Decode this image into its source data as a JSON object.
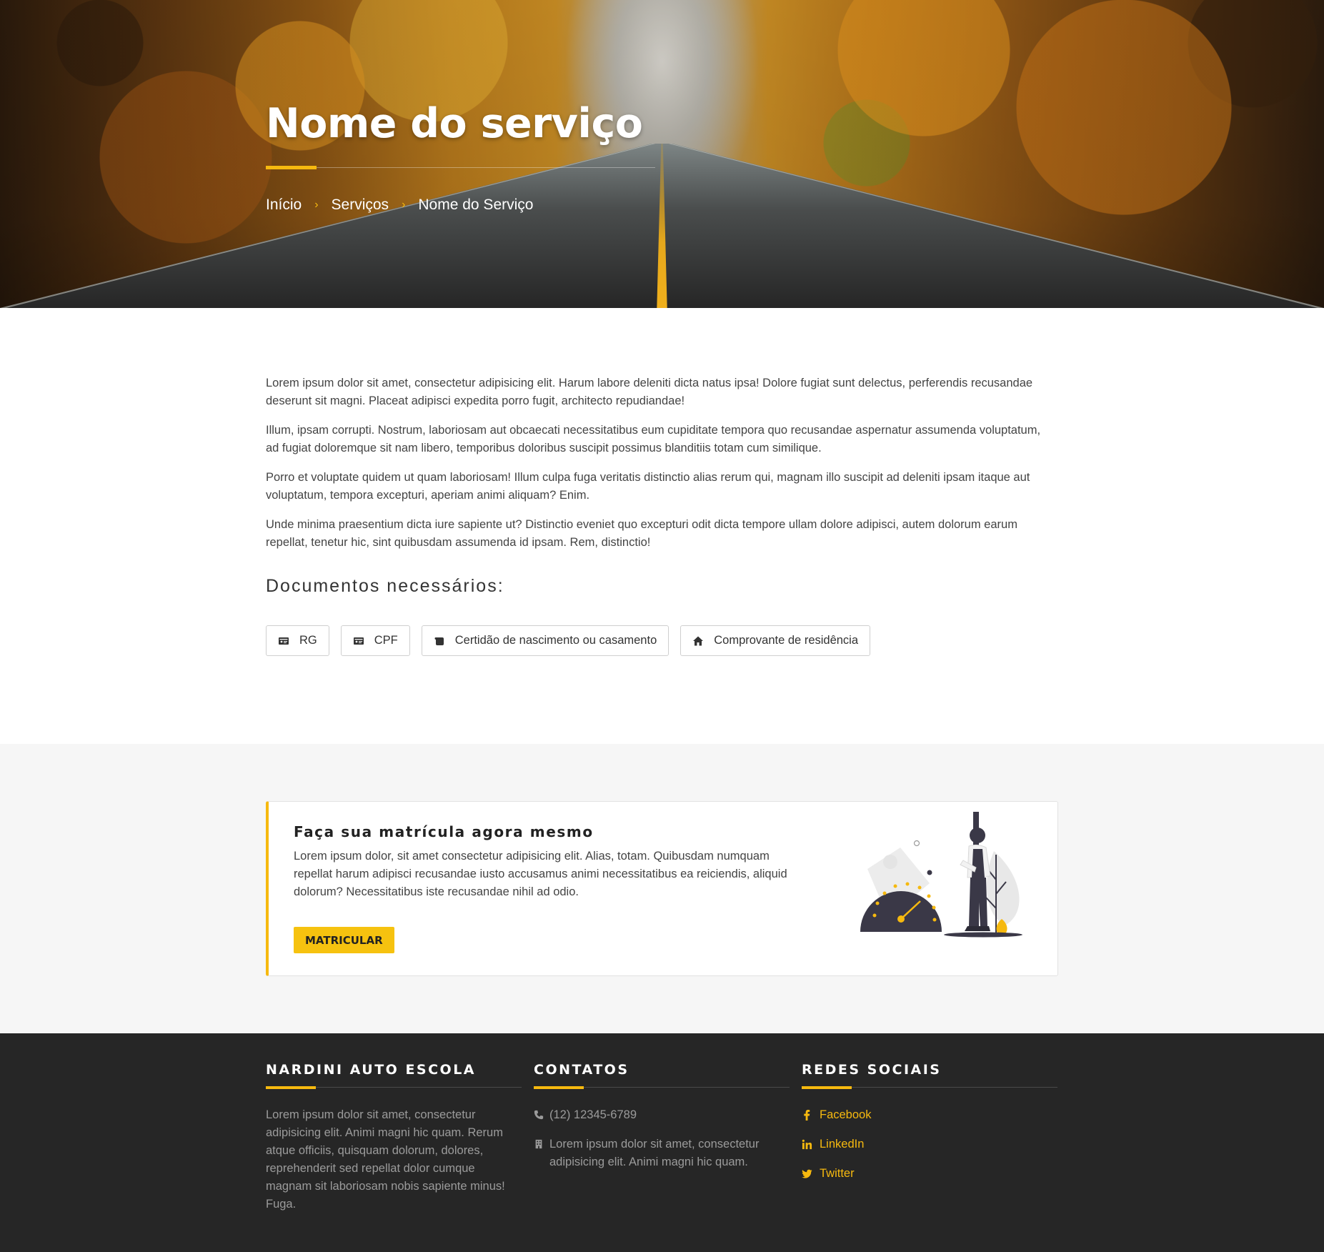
{
  "hero": {
    "title": "Nome do serviço",
    "breadcrumb": [
      {
        "label": "Início"
      },
      {
        "label": "Serviços"
      },
      {
        "label": "Nome do Serviço"
      }
    ],
    "separator": "›"
  },
  "content": {
    "paragraphs": [
      "Lorem ipsum dolor sit amet, consectetur adipisicing elit. Harum labore deleniti dicta natus ipsa! Dolore fugiat sunt delectus, perferendis recusandae deserunt sit magni. Placeat adipisci expedita porro fugit, architecto repudiandae!",
      "Illum, ipsam corrupti. Nostrum, laboriosam aut obcaecati necessitatibus eum cupiditate tempora quo recusandae aspernatur assumenda voluptatum, ad fugiat doloremque sit nam libero, temporibus doloribus suscipit possimus blanditiis totam cum similique.",
      "Porro et voluptate quidem ut quam laboriosam! Illum culpa fuga veritatis distinctio alias rerum qui, magnam illo suscipit ad deleniti ipsam itaque aut voluptatum, tempora excepturi, aperiam animi aliquam? Enim.",
      "Unde minima praesentium dicta iure sapiente ut? Distinctio eveniet quo excepturi odit dicta tempore ullam dolore adipisci, autem dolorum earum repellat, tenetur hic, sint quibusdam assumenda id ipsam. Rem, distinctio!"
    ],
    "docs_title": "Documentos necessários:",
    "documents": [
      {
        "label": "RG",
        "icon": "id-card-icon"
      },
      {
        "label": "CPF",
        "icon": "id-card-icon"
      },
      {
        "label": "Certidão de nascimento ou casamento",
        "icon": "scroll-icon"
      },
      {
        "label": "Comprovante de residência",
        "icon": "home-icon"
      }
    ]
  },
  "cta": {
    "title": "Faça sua matrícula agora mesmo",
    "body": "Lorem ipsum dolor, sit amet consectetur adipisicing elit. Alias, totam. Quibusdam numquam repellat harum adipisci recusandae iusto accusamus animi necessitatibus ea reiciendis, aliquid dolorum? Necessitatibus iste recusandae nihil ad odio.",
    "button": "MATRICULAR",
    "illustration": "speedometer-person-illustration"
  },
  "footer": {
    "about": {
      "heading": "NARDINI AUTO ESCOLA",
      "text": "Lorem ipsum dolor sit amet, consectetur adipisicing elit. Animi magni hic quam. Rerum atque officiis, quisquam dolorum, dolores, reprehenderit sed repellat dolor cumque magnam sit laboriosam nobis sapiente minus! Fuga."
    },
    "contacts": {
      "heading": "CONTATOS",
      "phone": "(12) 12345-6789",
      "address": "Lorem ipsum dolor sit amet, consectetur adipisicing elit. Animi magni hic quam."
    },
    "social": {
      "heading": "REDES SOCIAIS",
      "links": [
        {
          "label": "Facebook",
          "icon": "facebook-icon"
        },
        {
          "label": "LinkedIn",
          "icon": "linkedin-icon"
        },
        {
          "label": "Twitter",
          "icon": "twitter-icon"
        }
      ]
    }
  },
  "colors": {
    "accent": "#f6b90f",
    "footer_bg": "#262626",
    "section_bg": "#f6f6f6"
  }
}
